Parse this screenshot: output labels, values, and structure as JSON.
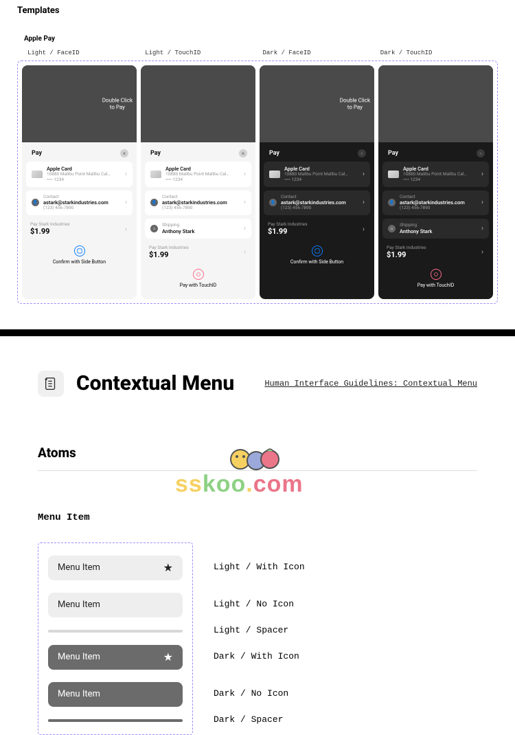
{
  "templates": {
    "heading": "Templates",
    "section": "Apple Pay",
    "variants": [
      "Light / FaceID",
      "Light / TouchID",
      "Dark / FaceID",
      "Dark / TouchID"
    ],
    "doubleClick": "Double Click\nto Pay",
    "payLabel": "Pay",
    "appleCard": {
      "title": "Apple Card",
      "subtitle": "10880 Malibu Point Malibu Cal…",
      "digits": "•••• 1234"
    },
    "contact": {
      "label": "Contact",
      "email": "astark@starkindustries.com",
      "phone": "(123) 456-7890"
    },
    "shipping": {
      "label": "Shipping",
      "name": "Anthony Stark"
    },
    "total": {
      "merchant": "Pay Stark Industries",
      "amount": "$1.99"
    },
    "confirmSide": "Confirm with Side Button",
    "confirmTouch": "Pay with TouchID"
  },
  "ctx": {
    "title": "Contextual Menu",
    "higLink": "Human Interface Guidelines: Contextual Menu",
    "atoms": "Atoms",
    "menuItemHeading": "Menu Item",
    "itemLabel": "Menu Item",
    "labels": [
      "Light / With Icon",
      "Light / No Icon",
      "Light / Spacer",
      "Dark / With Icon",
      "Dark / No Icon",
      "Dark / Spacer"
    ]
  },
  "watermark": "sskoo.com"
}
